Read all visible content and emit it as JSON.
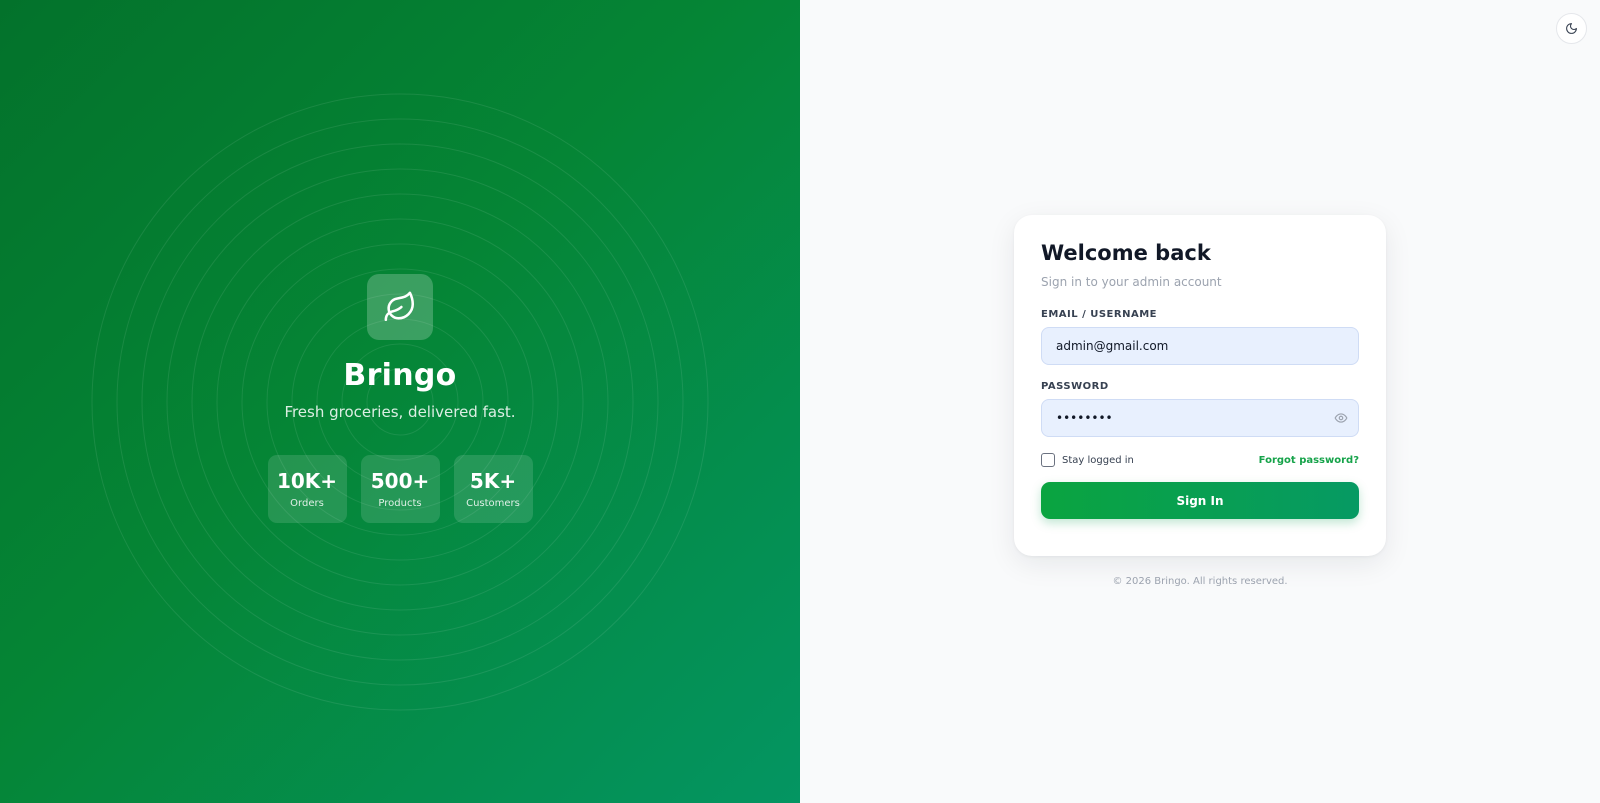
{
  "brand": {
    "name": "Bringo",
    "tagline": "Fresh groceries, delivered fast.",
    "logo_icon": "leaf-icon"
  },
  "stats": [
    {
      "value": "10K+",
      "label": "Orders"
    },
    {
      "value": "500+",
      "label": "Products"
    },
    {
      "value": "5K+",
      "label": "Customers"
    }
  ],
  "login": {
    "title": "Welcome back",
    "subtitle": "Sign in to your admin account",
    "email_label": "EMAIL / USERNAME",
    "email_value": "admin@gmail.com",
    "password_label": "PASSWORD",
    "password_value": "12345678",
    "remember_label": "Stay logged in",
    "remember_checked": false,
    "forgot_label": "Forgot password?",
    "submit_label": "Sign In"
  },
  "footer": {
    "text": "© 2026 Bringo. All rights reserved."
  },
  "icons": {
    "theme_toggle": "moon-icon",
    "password_toggle": "eye-icon"
  },
  "colors": {
    "primary": "#16a34a",
    "panel_gradient_start": "#03722b",
    "panel_gradient_end": "#049562",
    "input_background": "#e8f0fe"
  }
}
